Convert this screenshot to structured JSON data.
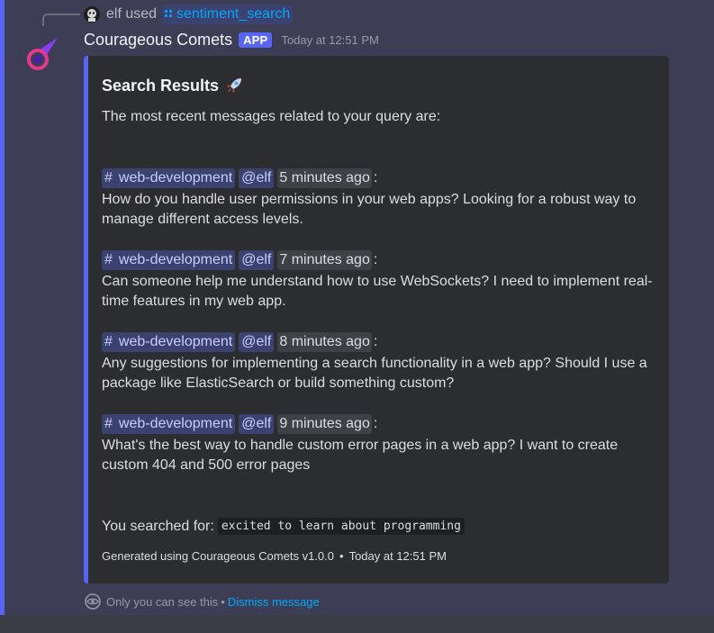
{
  "reply": {
    "user": "elf",
    "action": "used",
    "command": "sentiment_search"
  },
  "message": {
    "author": "Courageous Comets",
    "badge": "APP",
    "timestamp": "Today at 12:51 PM"
  },
  "embed": {
    "title": "Search Results",
    "title_icon": "rocket-emoji",
    "intro": "The most recent messages related to your query are:",
    "results": [
      {
        "channel": "web-development",
        "user": "@elf",
        "time": "5 minutes ago",
        "text": "How do you handle user permissions in your web apps? Looking for a robust way to manage different access levels."
      },
      {
        "channel": "web-development",
        "user": "@elf",
        "time": "7 minutes ago",
        "text": "Can someone help me understand how to use WebSockets? I need to implement real-time features in my web app."
      },
      {
        "channel": "web-development",
        "user": "@elf",
        "time": "8 minutes ago",
        "text": "Any suggestions for implementing a search functionality in a web app? Should I use a package like ElasticSearch or build something custom?"
      },
      {
        "channel": "web-development",
        "user": "@elf",
        "time": "9 minutes ago",
        "text": "What's the best way to handle custom error pages in a web app? I want to create custom 404 and 500 error pages"
      }
    ],
    "searched_label": "You searched for:",
    "query": "excited to learn about programming",
    "footer_text": "Generated using Courageous Comets v1.0.0",
    "footer_time": "Today at 12:51 PM"
  },
  "ephemeral": {
    "notice": "Only you can see this",
    "separator": "•",
    "dismiss": "Dismiss message"
  },
  "colors": {
    "accent": "#5865f2",
    "mention_bg": "#3c4270",
    "link": "#00a8fc",
    "embed_bg": "#2b2d31"
  }
}
